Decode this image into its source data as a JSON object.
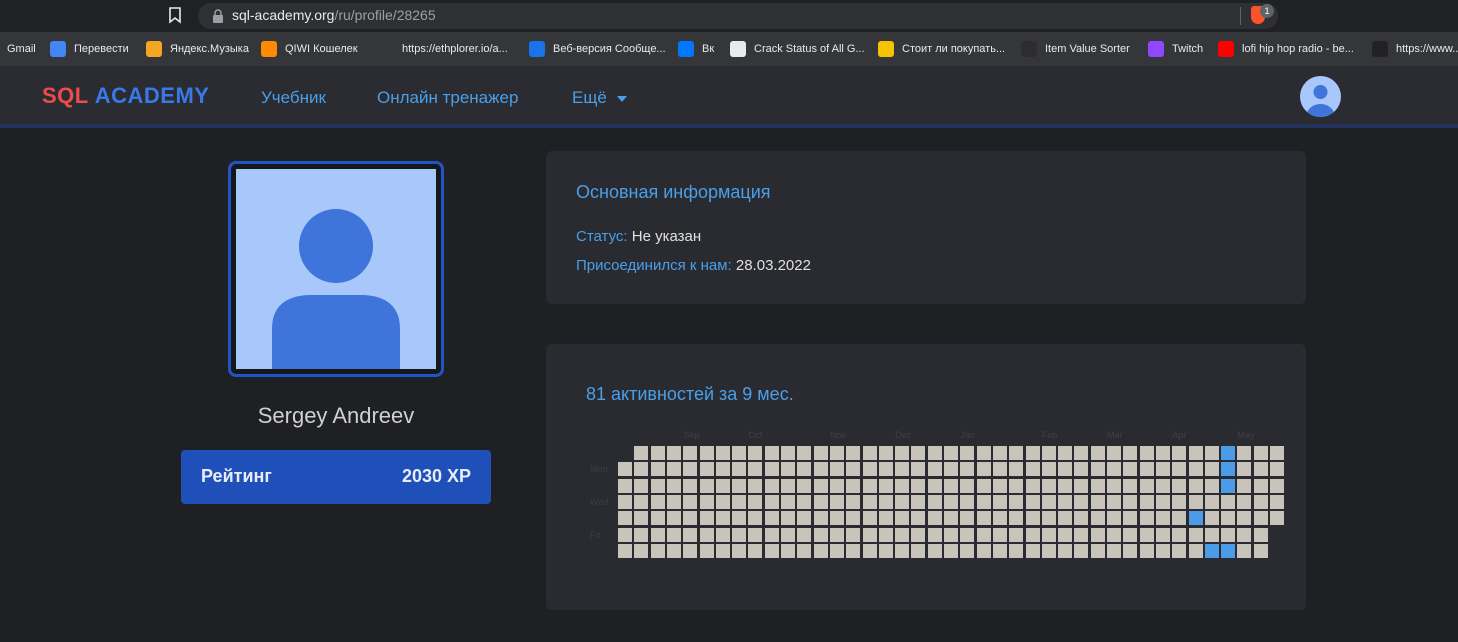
{
  "browser": {
    "url_host": "sql-academy.org",
    "url_path": "/ru/profile/28265",
    "brave_badge": "1",
    "bookmarks": [
      {
        "label": "Gmail",
        "icon": "gmail-icon",
        "color": "#35363a"
      },
      {
        "label": "Перевести",
        "icon": "translate-icon",
        "color": "#4285f4"
      },
      {
        "label": "Яндекс.Музыка",
        "icon": "yandex-music-icon",
        "color": "#f5a623"
      },
      {
        "label": "QIWI Кошелек",
        "icon": "qiwi-icon",
        "color": "#ff8c00"
      },
      {
        "label": "https://ethplorer.io/a...",
        "icon": "ethereum-icon",
        "color": "#35363a"
      },
      {
        "label": "Веб-версия Сообще...",
        "icon": "messages-icon",
        "color": "#1a73e8"
      },
      {
        "label": "Вк",
        "icon": "vk-icon",
        "color": "#0077ff"
      },
      {
        "label": "Crack Status of All G...",
        "icon": "globe-icon",
        "color": "#e8eaed"
      },
      {
        "label": "Стоит ли покупать...",
        "icon": "coin-icon",
        "color": "#f5c400"
      },
      {
        "label": "Item Value Sorter",
        "icon": "s-icon",
        "color": "#2d2d2d"
      },
      {
        "label": "Twitch",
        "icon": "twitch-icon",
        "color": "#9146ff"
      },
      {
        "label": "lofi hip hop radio - be...",
        "icon": "youtube-icon",
        "color": "#ff0000"
      },
      {
        "label": "https://www...",
        "icon": "arrow-icon",
        "color": "#222222"
      }
    ]
  },
  "header": {
    "logo_sql": "SQL",
    "logo_academy": "ACADEMY",
    "nav": [
      "Учебник",
      "Онлайн тренажер",
      "Ещё"
    ]
  },
  "profile": {
    "name": "Sergey Andreev",
    "rating_label": "Рейтинг",
    "rating_value": "2030 XP"
  },
  "info": {
    "title": "Основная информация",
    "status_label": "Статус:",
    "status_value": "Не указан",
    "joined_label": "Присоединился к нам:",
    "joined_value": "28.03.2022"
  },
  "activity": {
    "title": "81 активностей за 9 мес.",
    "months": [
      "Sep",
      "Oct",
      "Nov",
      "Dec",
      "Jan",
      "Feb",
      "Mar",
      "Apr",
      "May"
    ],
    "day_labels": [
      "Mon",
      "Wed",
      "Fri"
    ],
    "weeks": 41,
    "first_week_start_day": 1,
    "last_week_days": 5,
    "active_cells": [
      [
        37,
        0
      ],
      [
        37,
        1
      ],
      [
        37,
        2
      ],
      [
        35,
        4
      ],
      [
        36,
        6
      ],
      [
        37,
        6
      ]
    ],
    "colors": {
      "empty": "#c8c4bb",
      "active": "#4b9be8"
    }
  }
}
